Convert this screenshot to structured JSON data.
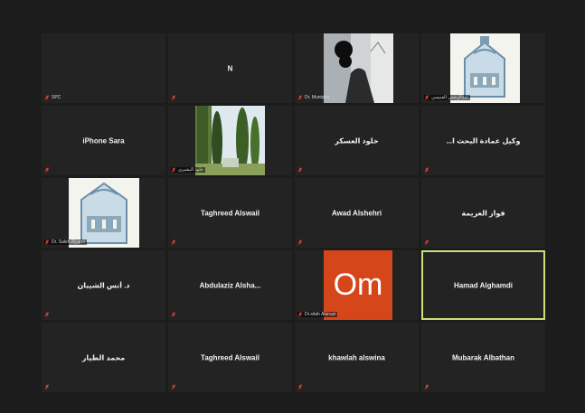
{
  "participants": [
    {
      "name": "",
      "label": "SPC"
    },
    {
      "name": "N",
      "label": ""
    },
    {
      "name": "",
      "label": "Dr. Muntaha"
    },
    {
      "name": "",
      "label": "عبدالرحمن العنيسي"
    },
    {
      "name": "iPhone Sara",
      "label": ""
    },
    {
      "name": "",
      "label": "خلود البشيرى"
    },
    {
      "name": "خلود العسكر",
      "label": ""
    },
    {
      "name": "...وكيل عمادة البحث ا",
      "label": ""
    },
    {
      "name": "",
      "label": "Dr. Saleh Alyami"
    },
    {
      "name": "Taghreed Alswail",
      "label": ""
    },
    {
      "name": "Awad Alshehri",
      "label": ""
    },
    {
      "name": "فواز العريمة",
      "label": ""
    },
    {
      "name": "د. أنس الشيبان",
      "label": ""
    },
    {
      "name": "Abdulaziz  Alsha...",
      "label": ""
    },
    {
      "name": "",
      "label": "Dr.sitah Alanazi",
      "avatar": "Om"
    },
    {
      "name": "Hamad Alghamdi",
      "label": ""
    },
    {
      "name": "محمد الطيار",
      "label": ""
    },
    {
      "name": "Taghreed Alswail",
      "label": ""
    },
    {
      "name": "khawlah alswina",
      "label": ""
    },
    {
      "name": "Mubarak Albathan",
      "label": ""
    }
  ],
  "colors": {
    "background": "#1c1c1c",
    "tile": "#232323",
    "active_border": "#c8e07a",
    "muted_icon": "#e0453a",
    "avatar_om": "#d6461b"
  },
  "icons": {
    "muted": "mic-muted-icon"
  }
}
